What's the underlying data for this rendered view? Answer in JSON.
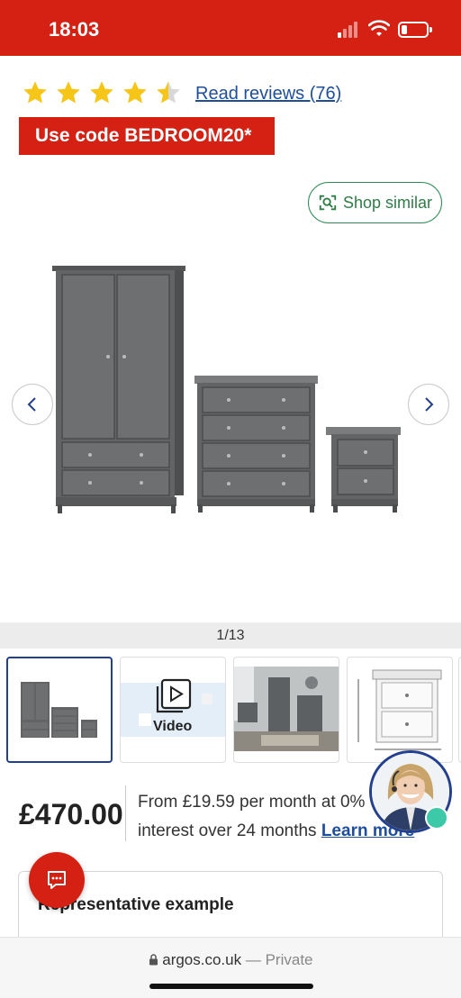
{
  "status_bar": {
    "time": "18:03",
    "signal_icon": "cellular-signal-icon",
    "wifi_icon": "wifi-icon",
    "battery_icon": "battery-low-icon",
    "background": "#d42114"
  },
  "rating": {
    "stars": 4.5,
    "max_stars": 5,
    "star_color": "#f5c518",
    "reviews_label": "Read reviews (76)"
  },
  "promo": {
    "label": "Use code BEDROOM20*"
  },
  "shop_similar": {
    "label": "Shop similar",
    "icon": "visual-search-icon"
  },
  "gallery": {
    "counter": "1/13",
    "prev_icon": "chevron-left-icon",
    "next_icon": "chevron-right-icon",
    "thumbnails": [
      {
        "label": "",
        "kind": "image",
        "selected": true
      },
      {
        "label": "Video",
        "kind": "video"
      },
      {
        "label": "",
        "kind": "image"
      },
      {
        "label": "",
        "kind": "image"
      }
    ]
  },
  "pricing": {
    "price": "£470.00",
    "finance_text_1": "From £19.59 per month at 0%",
    "finance_text_2": "interest over 24 months ",
    "learn_more": "Learn more"
  },
  "representative": {
    "title": "Representative example"
  },
  "chat": {
    "icon": "chat-bubble-icon"
  },
  "url_bar": {
    "domain": "argos.co.uk",
    "privacy": "— Private",
    "icon": "lock-icon"
  },
  "colors": {
    "brand_red": "#d42114",
    "link_blue": "#1f4e9c",
    "green": "#2e8b57"
  }
}
